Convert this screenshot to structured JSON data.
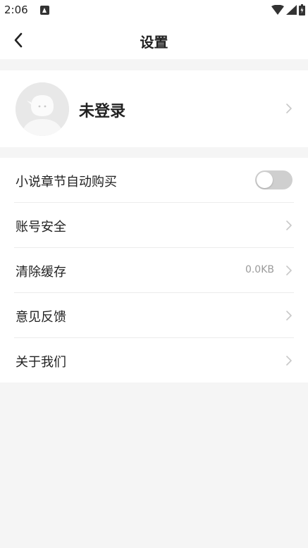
{
  "status_bar": {
    "time": "2:06",
    "icons": [
      "notification-icon",
      "wifi-icon",
      "signal-icon",
      "battery-icon"
    ]
  },
  "header": {
    "title": "设置",
    "back_icon": "back-arrow-icon"
  },
  "profile": {
    "name": "未登录",
    "avatar_icon": "default-avatar-icon"
  },
  "settings": {
    "items": [
      {
        "label": "小说章节自动购买",
        "type": "toggle",
        "enabled": false
      },
      {
        "label": "账号安全",
        "type": "link"
      },
      {
        "label": "清除缓存",
        "type": "link",
        "value": "0.0KB"
      },
      {
        "label": "意见反馈",
        "type": "link"
      },
      {
        "label": "关于我们",
        "type": "link"
      }
    ]
  },
  "colors": {
    "background": "#f5f5f5",
    "card": "#ffffff",
    "text": "#222222",
    "secondary_text": "#9a9a9a",
    "toggle_off": "#cfcfcf"
  }
}
